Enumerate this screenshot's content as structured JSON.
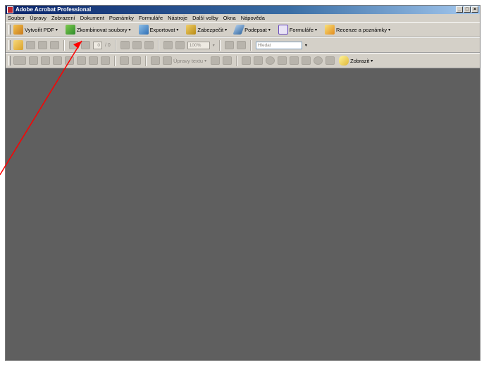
{
  "window": {
    "title": "Adobe Acrobat Professional",
    "min": "_",
    "restore": "□",
    "close": "×"
  },
  "menu": [
    "Soubor",
    "Úpravy",
    "Zobrazení",
    "Dokument",
    "Poznámky",
    "Formuláře",
    "Nástroje",
    "Další volby",
    "Okna",
    "Nápověda"
  ],
  "toolbar": {
    "create_pdf": "Vytvořit PDF",
    "combine": "Zkombinovat soubory",
    "export": "Exportovat",
    "secure": "Zabezpečit",
    "sign": "Podepsat",
    "forms": "Formuláře",
    "review": "Recenze a poznámky",
    "caret": "▾"
  },
  "nav": {
    "page": "0",
    "of": "/ 0",
    "zoom": "100%",
    "search_placeholder": "Hledat"
  },
  "edit": {
    "text_edits": "Úpravy textu",
    "show": "Zobrazit"
  },
  "colors": {
    "accent": "#ff0000",
    "doc_bg": "#5f5f5f",
    "chrome": "#d4d0c8"
  }
}
